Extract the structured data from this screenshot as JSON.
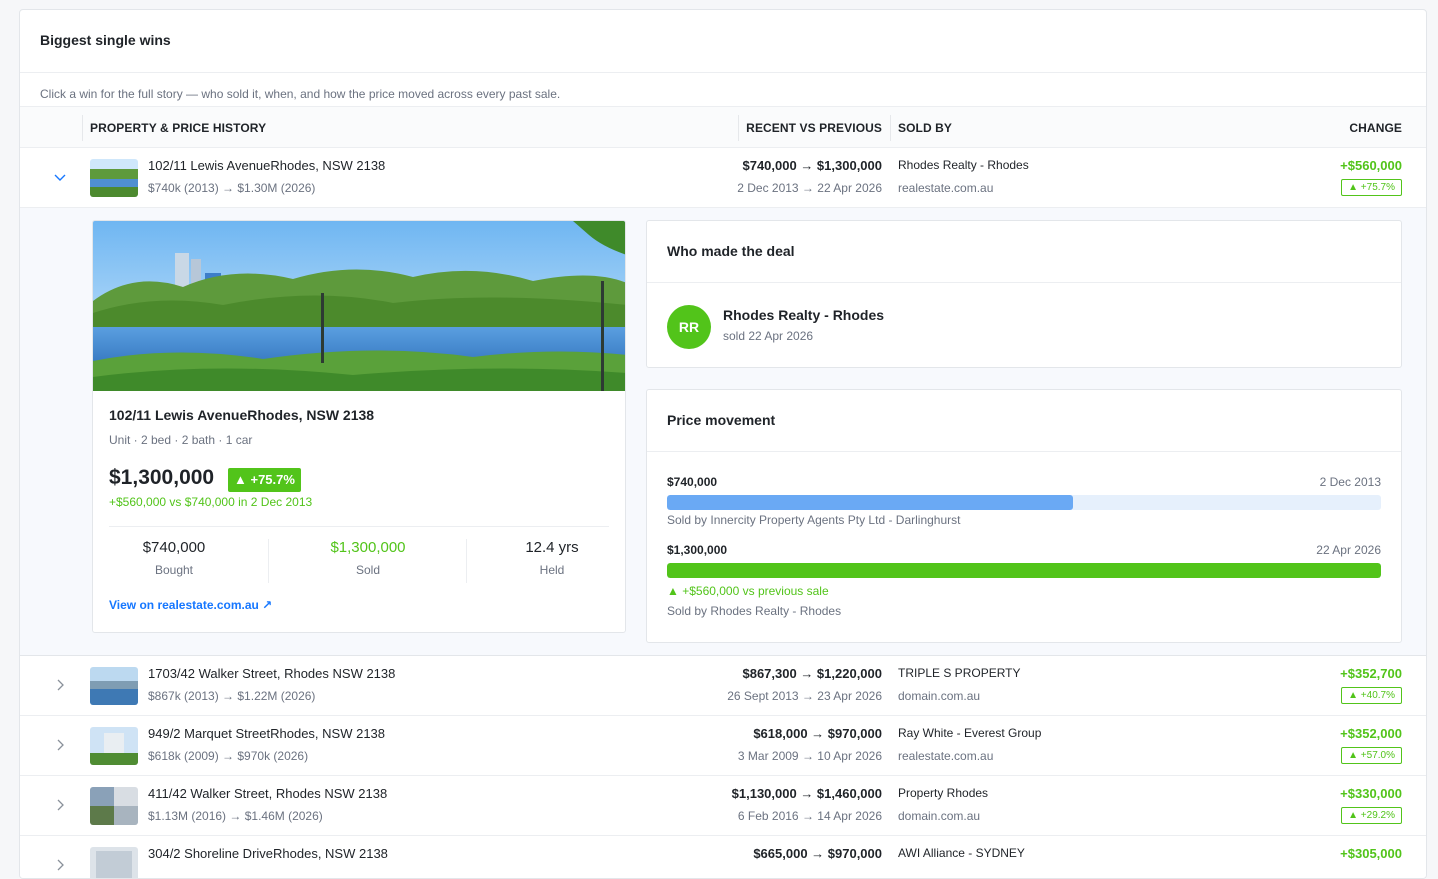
{
  "title": "Biggest single wins",
  "subtitle": "Click a win for the full story — who sold it, when, and how the price moved across every past sale.",
  "columns": {
    "property": "PROPERTY & PRICE HISTORY",
    "recent": "RECENT VS PREVIOUS",
    "sold_by": "SOLD BY",
    "change": "CHANGE"
  },
  "rows": [
    {
      "address": "102/11 Lewis AvenueRhodes, NSW 2138",
      "history": "$740k (2013) → $1.30M (2026)",
      "prices": "$740,000 → $1,300,000",
      "dates": "2 Dec 2013 → 22 Apr 2026",
      "agent": "Rhodes Realty - Rhodes",
      "source": "realestate.com.au",
      "change": "+$560,000",
      "pct": "▲ +75.7%",
      "expanded_icon": "chevron-down"
    },
    {
      "address": "1703/42 Walker Street, Rhodes NSW 2138",
      "history": "$867k (2013) → $1.22M (2026)",
      "prices": "$867,300 → $1,220,000",
      "dates": "26 Sept 2013 → 23 Apr 2026",
      "agent": "TRIPLE S PROPERTY",
      "source": "domain.com.au",
      "change": "+$352,700",
      "pct": "▲ +40.7%"
    },
    {
      "address": "949/2 Marquet StreetRhodes, NSW 2138",
      "history": "$618k (2009) → $970k (2026)",
      "prices": "$618,000 → $970,000",
      "dates": "3 Mar 2009 → 10 Apr 2026",
      "agent": "Ray White - Everest Group",
      "source": "realestate.com.au",
      "change": "+$352,000",
      "pct": "▲ +57.0%"
    },
    {
      "address": "411/42 Walker Street, Rhodes NSW 2138",
      "history": "$1.13M (2016) → $1.46M (2026)",
      "prices": "$1,130,000 → $1,460,000",
      "dates": "6 Feb 2016 → 14 Apr 2026",
      "agent": "Property Rhodes",
      "source": "domain.com.au",
      "change": "+$330,000",
      "pct": "▲ +29.2%"
    },
    {
      "address": "304/2 Shoreline DriveRhodes, NSW 2138",
      "history": "",
      "prices": "$665,000 → $970,000",
      "dates": "",
      "agent": "AWI Alliance - SYDNEY",
      "source": "",
      "change": "+$305,000",
      "pct": ""
    }
  ],
  "detail": {
    "title": "102/11 Lewis AvenueRhodes, NSW 2138",
    "spec": "Unit · 2 bed · 2 bath · 1 car",
    "price": "$1,300,000",
    "pct": "▲ +75.7%",
    "delta": "+$560,000 vs $740,000 in 2 Dec 2013",
    "stats": [
      {
        "value": "$740,000",
        "label": "Bought"
      },
      {
        "value": "$1,300,000",
        "label": "Sold"
      },
      {
        "value": "12.4 yrs",
        "label": "Held"
      }
    ],
    "link": "View on realestate.com.au ↗"
  },
  "deal": {
    "heading": "Who made the deal",
    "initials": "RR",
    "agent": "Rhodes Realty - Rhodes",
    "sold": "sold 22 Apr 2026"
  },
  "movement": {
    "heading": "Price movement",
    "sales": [
      {
        "price": "$740,000",
        "date": "2 Dec 2013",
        "fraction": 0.569,
        "color": "#6aa9f4",
        "note": "Sold by Innercity Property Agents Pty Ltd - Darlinghurst"
      },
      {
        "price": "$1,300,000",
        "date": "22 Apr 2026",
        "fraction": 1.0,
        "color": "#52c41a",
        "gain": "▲ +$560,000 vs previous sale",
        "note": "Sold by Rhodes Realty - Rhodes"
      }
    ]
  },
  "colors": {
    "accent_green": "#52c41a",
    "link_blue": "#1677ff",
    "bar_blue": "#6aa9f4"
  }
}
